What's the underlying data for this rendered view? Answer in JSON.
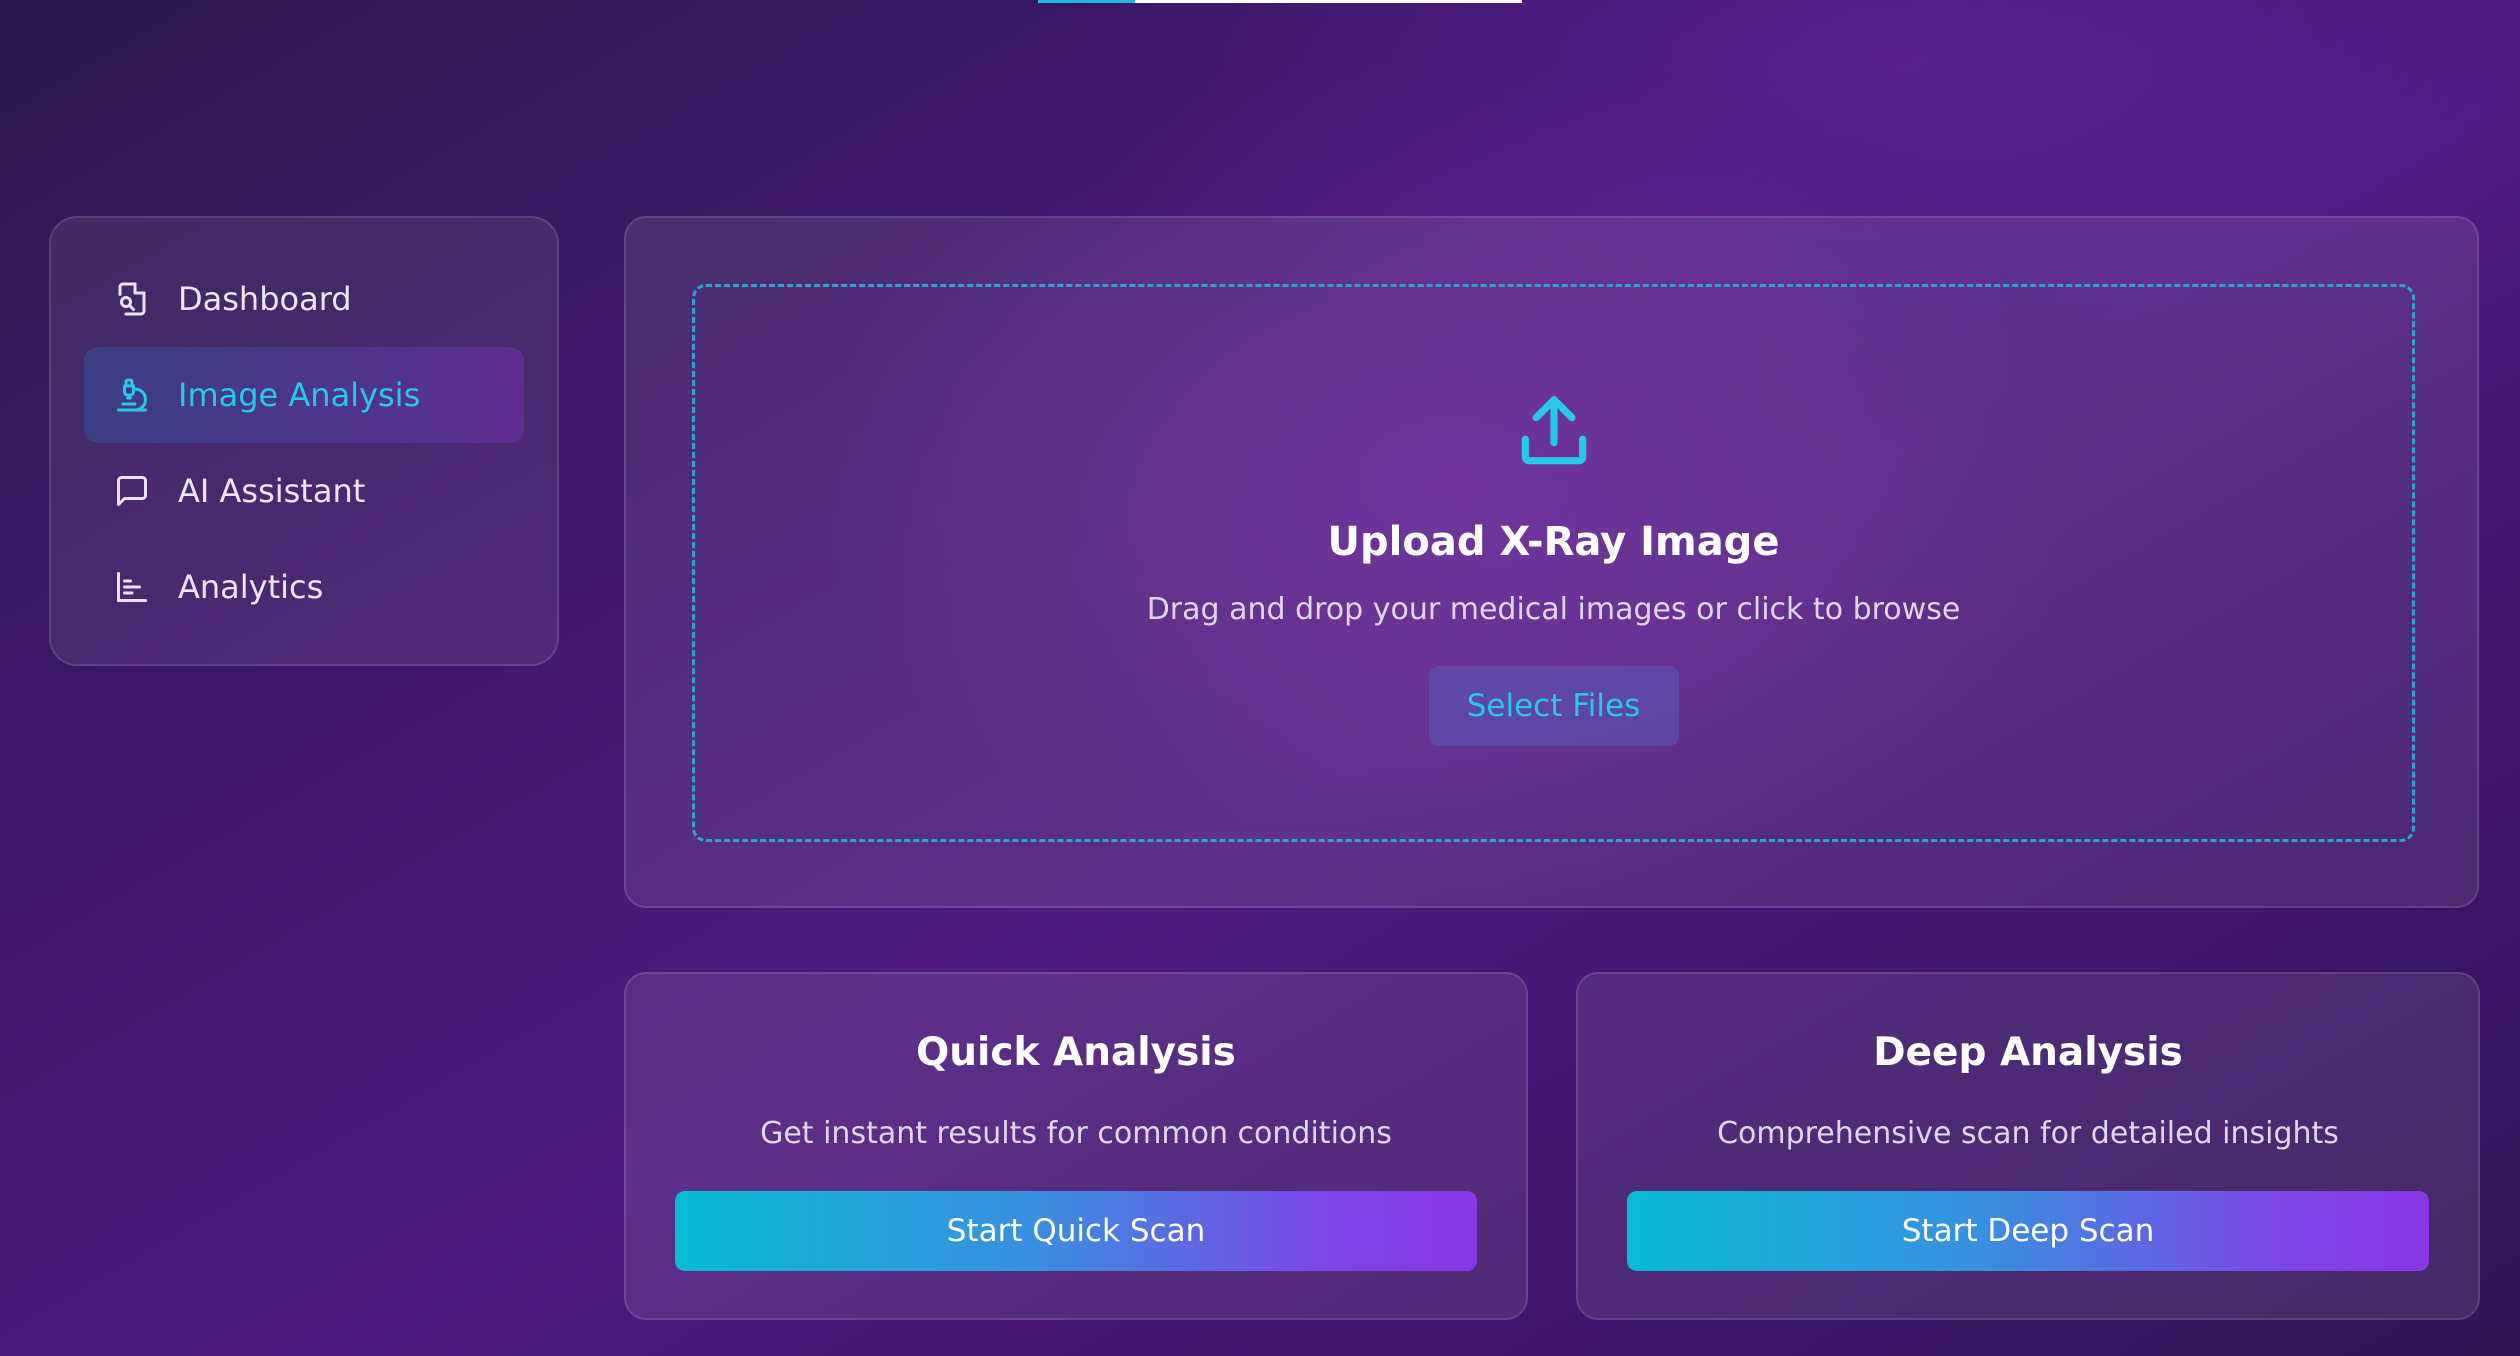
{
  "top_progress": {
    "value": 0.2
  },
  "sidebar": {
    "items": [
      {
        "label": "Dashboard",
        "icon": "file-search-icon",
        "active": false
      },
      {
        "label": "Image Analysis",
        "icon": "microscope-icon",
        "active": true
      },
      {
        "label": "AI Assistant",
        "icon": "chat-icon",
        "active": false
      },
      {
        "label": "Analytics",
        "icon": "bar-chart-icon",
        "active": false
      }
    ]
  },
  "upload": {
    "icon": "upload-icon",
    "title": "Upload X-Ray Image",
    "subtitle": "Drag and drop your medical images or click to browse",
    "button_label": "Select Files"
  },
  "cards": {
    "quick": {
      "title": "Quick Analysis",
      "description": "Get instant results for common conditions",
      "button_label": "Start Quick Scan"
    },
    "deep": {
      "title": "Deep Analysis",
      "description": "Comprehensive scan for detailed insights",
      "button_label": "Start Deep Scan"
    }
  },
  "colors": {
    "accent": "#27c8e8",
    "gradient_start": "#08bcd4",
    "gradient_end": "#8a36e6"
  }
}
